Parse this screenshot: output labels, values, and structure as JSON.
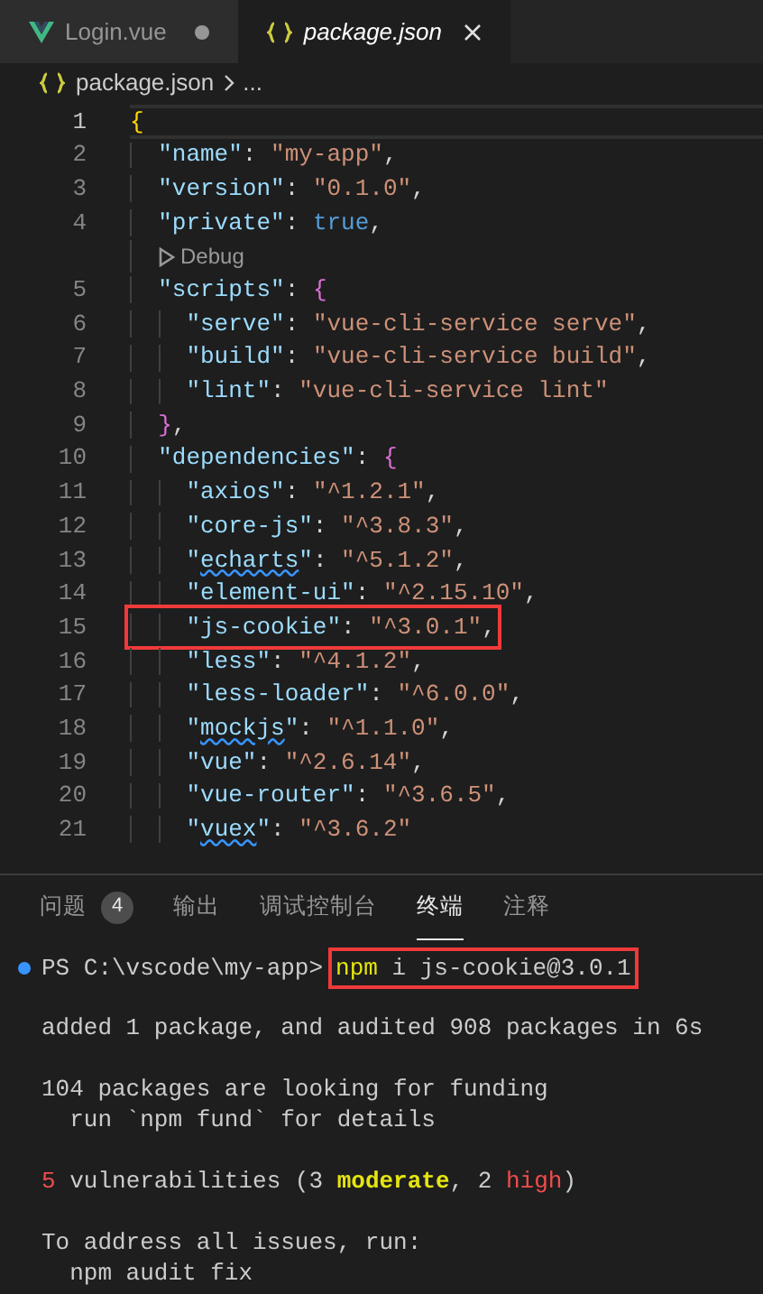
{
  "tabs": [
    {
      "kind": "vue",
      "label": "Login.vue",
      "selected": false,
      "italic": false,
      "dirty": true
    },
    {
      "kind": "json",
      "label": "package.json",
      "selected": true,
      "italic": true,
      "dirty": false
    }
  ],
  "breadcrumb": [
    "package.json",
    "..."
  ],
  "editor": {
    "lines": [
      {
        "kind": "code",
        "number": "1",
        "active": true,
        "boxed": false,
        "tokens": [
          {
            "kind": "brace1",
            "text": "{"
          }
        ]
      },
      {
        "kind": "code",
        "number": "2",
        "active": false,
        "boxed": false,
        "tokens": [
          {
            "kind": "key",
            "text": "  \"name\""
          },
          {
            "kind": "punct",
            "text": ": "
          },
          {
            "kind": "string",
            "text": "\"my-app\""
          },
          {
            "kind": "punct",
            "text": ","
          }
        ]
      },
      {
        "kind": "code",
        "number": "3",
        "active": false,
        "boxed": false,
        "tokens": [
          {
            "kind": "key",
            "text": "  \"version\""
          },
          {
            "kind": "punct",
            "text": ": "
          },
          {
            "kind": "string",
            "text": "\"0.1.0\""
          },
          {
            "kind": "punct",
            "text": ","
          }
        ]
      },
      {
        "kind": "code",
        "number": "4",
        "active": false,
        "boxed": false,
        "tokens": [
          {
            "kind": "key",
            "text": "  \"private\""
          },
          {
            "kind": "punct",
            "text": ": "
          },
          {
            "kind": "bool",
            "text": "true"
          },
          {
            "kind": "punct",
            "text": ","
          }
        ]
      },
      {
        "kind": "codelens",
        "text": "Debug"
      },
      {
        "kind": "code",
        "number": "5",
        "active": false,
        "boxed": false,
        "tokens": [
          {
            "kind": "key",
            "text": "  \"scripts\""
          },
          {
            "kind": "punct",
            "text": ": "
          },
          {
            "kind": "brace2",
            "text": "{"
          }
        ]
      },
      {
        "kind": "code",
        "number": "6",
        "active": false,
        "boxed": false,
        "tokens": [
          {
            "kind": "key",
            "text": "    \"serve\""
          },
          {
            "kind": "punct",
            "text": ": "
          },
          {
            "kind": "string",
            "text": "\"vue-cli-service serve\""
          },
          {
            "kind": "punct",
            "text": ","
          }
        ]
      },
      {
        "kind": "code",
        "number": "7",
        "active": false,
        "boxed": false,
        "tokens": [
          {
            "kind": "key",
            "text": "    \"build\""
          },
          {
            "kind": "punct",
            "text": ": "
          },
          {
            "kind": "string",
            "text": "\"vue-cli-service build\""
          },
          {
            "kind": "punct",
            "text": ","
          }
        ]
      },
      {
        "kind": "code",
        "number": "8",
        "active": false,
        "boxed": false,
        "tokens": [
          {
            "kind": "key",
            "text": "    \"lint\""
          },
          {
            "kind": "punct",
            "text": ": "
          },
          {
            "kind": "string",
            "text": "\"vue-cli-service lint\""
          }
        ]
      },
      {
        "kind": "code",
        "number": "9",
        "active": false,
        "boxed": false,
        "tokens": [
          {
            "kind": "brace2",
            "text": "  }"
          },
          {
            "kind": "punct",
            "text": ","
          }
        ]
      },
      {
        "kind": "code",
        "number": "10",
        "active": false,
        "boxed": false,
        "tokens": [
          {
            "kind": "key",
            "text": "  \"dependencies\""
          },
          {
            "kind": "punct",
            "text": ": "
          },
          {
            "kind": "brace2",
            "text": "{"
          }
        ]
      },
      {
        "kind": "code",
        "number": "11",
        "active": false,
        "boxed": false,
        "tokens": [
          {
            "kind": "key",
            "text": "    \"axios\""
          },
          {
            "kind": "punct",
            "text": ": "
          },
          {
            "kind": "string",
            "text": "\"^1.2.1\""
          },
          {
            "kind": "punct",
            "text": ","
          }
        ]
      },
      {
        "kind": "code",
        "number": "12",
        "active": false,
        "boxed": false,
        "tokens": [
          {
            "kind": "key",
            "text": "    \"core-js\""
          },
          {
            "kind": "punct",
            "text": ": "
          },
          {
            "kind": "string",
            "text": "\"^3.8.3\""
          },
          {
            "kind": "punct",
            "text": ","
          }
        ]
      },
      {
        "kind": "code",
        "number": "13",
        "active": false,
        "boxed": false,
        "tokens": [
          {
            "kind": "key",
            "text": "    \""
          },
          {
            "kind": "key-squiggle",
            "text": "echarts"
          },
          {
            "kind": "key",
            "text": "\""
          },
          {
            "kind": "punct",
            "text": ": "
          },
          {
            "kind": "string",
            "text": "\"^5.1.2\""
          },
          {
            "kind": "punct",
            "text": ","
          }
        ]
      },
      {
        "kind": "code",
        "number": "14",
        "active": false,
        "boxed": false,
        "tokens": [
          {
            "kind": "key",
            "text": "    \"element-ui\""
          },
          {
            "kind": "punct",
            "text": ": "
          },
          {
            "kind": "string",
            "text": "\"^2.15.10\""
          },
          {
            "kind": "punct",
            "text": ","
          }
        ]
      },
      {
        "kind": "code",
        "number": "15",
        "active": false,
        "boxed": true,
        "tokens": [
          {
            "kind": "key",
            "text": "    \"js-cookie\""
          },
          {
            "kind": "punct",
            "text": ": "
          },
          {
            "kind": "string",
            "text": "\"^3.0.1\""
          },
          {
            "kind": "punct",
            "text": ","
          }
        ]
      },
      {
        "kind": "code",
        "number": "16",
        "active": false,
        "boxed": false,
        "tokens": [
          {
            "kind": "key",
            "text": "    \"less\""
          },
          {
            "kind": "punct",
            "text": ": "
          },
          {
            "kind": "string",
            "text": "\"^4.1.2\""
          },
          {
            "kind": "punct",
            "text": ","
          }
        ]
      },
      {
        "kind": "code",
        "number": "17",
        "active": false,
        "boxed": false,
        "tokens": [
          {
            "kind": "key",
            "text": "    \"less-loader\""
          },
          {
            "kind": "punct",
            "text": ": "
          },
          {
            "kind": "string",
            "text": "\"^6.0.0\""
          },
          {
            "kind": "punct",
            "text": ","
          }
        ]
      },
      {
        "kind": "code",
        "number": "18",
        "active": false,
        "boxed": false,
        "tokens": [
          {
            "kind": "key",
            "text": "    \""
          },
          {
            "kind": "key-squiggle",
            "text": "mockjs"
          },
          {
            "kind": "key",
            "text": "\""
          },
          {
            "kind": "punct",
            "text": ": "
          },
          {
            "kind": "string",
            "text": "\"^1.1.0\""
          },
          {
            "kind": "punct",
            "text": ","
          }
        ]
      },
      {
        "kind": "code",
        "number": "19",
        "active": false,
        "boxed": false,
        "tokens": [
          {
            "kind": "key",
            "text": "    \"vue\""
          },
          {
            "kind": "punct",
            "text": ": "
          },
          {
            "kind": "string",
            "text": "\"^2.6.14\""
          },
          {
            "kind": "punct",
            "text": ","
          }
        ]
      },
      {
        "kind": "code",
        "number": "20",
        "active": false,
        "boxed": false,
        "tokens": [
          {
            "kind": "key",
            "text": "    \"vue-router\""
          },
          {
            "kind": "punct",
            "text": ": "
          },
          {
            "kind": "string",
            "text": "\"^3.6.5\""
          },
          {
            "kind": "punct",
            "text": ","
          }
        ]
      },
      {
        "kind": "code",
        "number": "21",
        "active": false,
        "boxed": false,
        "tokens": [
          {
            "kind": "key",
            "text": "    \""
          },
          {
            "kind": "key-squiggle",
            "text": "vuex"
          },
          {
            "kind": "key",
            "text": "\""
          },
          {
            "kind": "punct",
            "text": ": "
          },
          {
            "kind": "string",
            "text": "\"^3.6.2\""
          }
        ]
      }
    ]
  },
  "panel": {
    "tabs": [
      {
        "label": "问题",
        "badge": "4",
        "selected": false
      },
      {
        "label": "输出",
        "selected": false
      },
      {
        "label": "调试控制台",
        "selected": false
      },
      {
        "label": "终端",
        "selected": true
      },
      {
        "label": "注释",
        "selected": false
      }
    ],
    "terminal": [
      {
        "kind": "prompt",
        "prompt": "PS C:\\vscode\\my-app>",
        "boxed": true,
        "command": [
          {
            "kind": "keyword",
            "text": "npm"
          },
          {
            "kind": "plain",
            "text": " i js-cookie@3.0.1"
          }
        ]
      },
      {
        "kind": "blank"
      },
      {
        "kind": "output",
        "segments": [
          {
            "kind": "plain",
            "text": "added 1 package, and audited 908 packages in 6s"
          }
        ]
      },
      {
        "kind": "blank"
      },
      {
        "kind": "output",
        "segments": [
          {
            "kind": "plain",
            "text": "104 packages are looking for funding"
          }
        ]
      },
      {
        "kind": "output",
        "segments": [
          {
            "kind": "plain",
            "text": "  run `npm fund` for details"
          }
        ]
      },
      {
        "kind": "blank"
      },
      {
        "kind": "output",
        "segments": [
          {
            "kind": "error",
            "text": "5"
          },
          {
            "kind": "plain",
            "text": " vulnerabilities (3 "
          },
          {
            "kind": "warning",
            "text": "moderate"
          },
          {
            "kind": "plain",
            "text": ", 2 "
          },
          {
            "kind": "error",
            "text": "high"
          },
          {
            "kind": "plain",
            "text": ")"
          }
        ]
      },
      {
        "kind": "blank"
      },
      {
        "kind": "output",
        "segments": [
          {
            "kind": "plain",
            "text": "To address all issues, run:"
          }
        ]
      },
      {
        "kind": "output",
        "segments": [
          {
            "kind": "plain",
            "text": "  npm audit fix"
          }
        ]
      }
    ]
  }
}
